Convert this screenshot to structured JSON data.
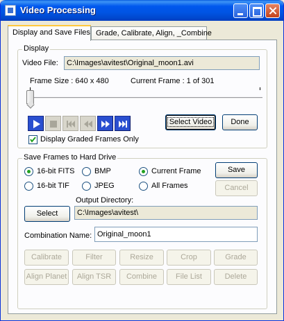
{
  "window": {
    "title": "Video Processing"
  },
  "tabs": [
    {
      "label": "Display and Save Files",
      "active": true
    },
    {
      "label": "Grade, Calibrate, Align, _Combine",
      "active": false
    }
  ],
  "display": {
    "legend": "Display",
    "video_file_label": "Video File:",
    "video_file_value": "C:\\Images\\avitest\\Original_moon1.avi",
    "frame_size_text": "Frame Size : 640 x 480",
    "current_frame_text": "Current Frame : 1 of 301",
    "current_frame": 1,
    "total_frames": 301,
    "select_video_label": "Select Video",
    "done_label": "Done",
    "graded_only_label": "Display Graded Frames Only",
    "graded_only_checked": true
  },
  "save": {
    "legend": "Save Frames to Hard Drive",
    "format_options": [
      {
        "label": "16-bit FITS",
        "selected": true
      },
      {
        "label": "BMP",
        "selected": false
      },
      {
        "label": "16-bit TIF",
        "selected": false
      },
      {
        "label": "JPEG",
        "selected": false
      }
    ],
    "frame_options": [
      {
        "label": "Current Frame",
        "selected": true
      },
      {
        "label": "All Frames",
        "selected": false
      }
    ],
    "save_label": "Save",
    "cancel_label": "Cancel",
    "output_dir_label": "Output Directory:",
    "select_label": "Select",
    "output_dir_value": "C:\\Images\\avitest\\",
    "combination_label": "Combination Name:",
    "combination_value": "Original_moon1"
  },
  "actions": {
    "row1": [
      "Calibrate",
      "Filter",
      "Resize",
      "Crop",
      "Grade"
    ],
    "row2": [
      "Align Planet",
      "Align TSR",
      "Combine",
      "File List",
      "Delete"
    ]
  }
}
